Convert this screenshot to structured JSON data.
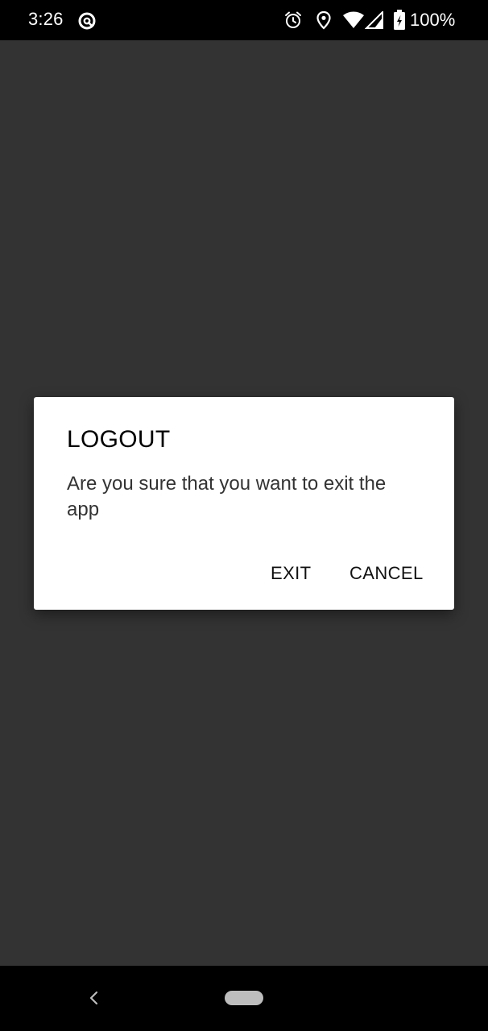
{
  "status_bar": {
    "time": "3:26",
    "battery_percent": "100%",
    "icons": [
      "app-notification-icon",
      "alarm-icon",
      "location-icon",
      "wifi-icon",
      "cell-signal-icon",
      "battery-charging-icon"
    ]
  },
  "dialog": {
    "title": "LOGOUT",
    "message": "Are you sure that you want to exit the app",
    "exit_label": "EXIT",
    "cancel_label": "CANCEL"
  },
  "nav_bar": {
    "icons": [
      "back-icon",
      "home-pill"
    ]
  },
  "colors": {
    "scrim": "#333333",
    "dialog_bg": "#ffffff",
    "bars": "#000000"
  }
}
